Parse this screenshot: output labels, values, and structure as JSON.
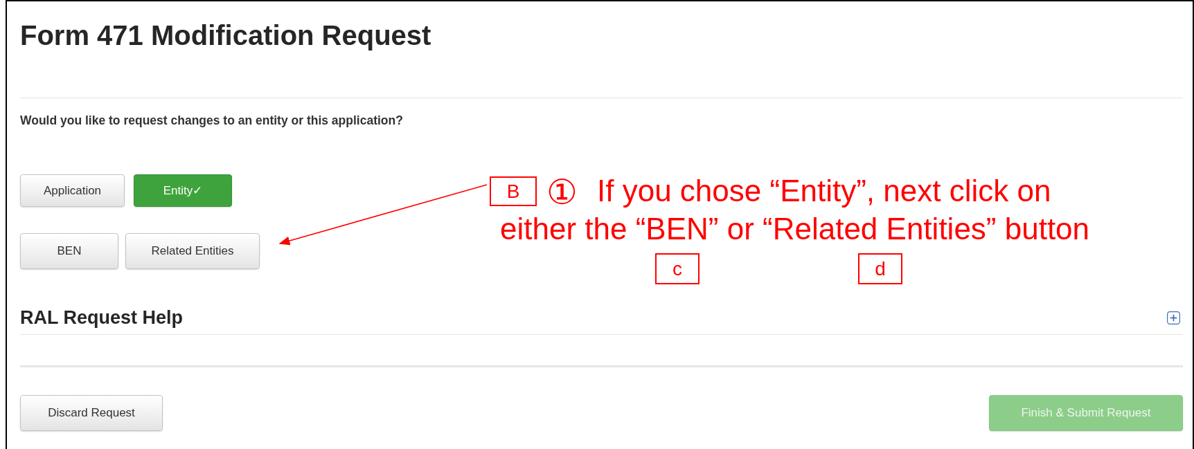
{
  "title": "Form 471 Modification Request",
  "question": "Would you like to request changes to an entity or this application?",
  "mode_buttons": [
    {
      "label": "Application",
      "selected": false
    },
    {
      "label": "Entity✓",
      "selected": true
    }
  ],
  "entity_buttons": [
    {
      "label": "BEN"
    },
    {
      "label": "Related Entities"
    }
  ],
  "help_section": {
    "title": "RAL Request Help",
    "expanded": false
  },
  "footer_buttons": [
    {
      "label": "Discard Request",
      "kind": "secondary",
      "disabled": false
    },
    {
      "label": "Finish & Submit Request",
      "kind": "primary",
      "disabled": true
    }
  ],
  "annotation": {
    "tag": "B",
    "step": "①",
    "lines": [
      "If you chose “Entity”, next click on",
      "either the “BEN” or “Related Entities” button"
    ],
    "sub_tags": [
      "c",
      "d"
    ]
  }
}
